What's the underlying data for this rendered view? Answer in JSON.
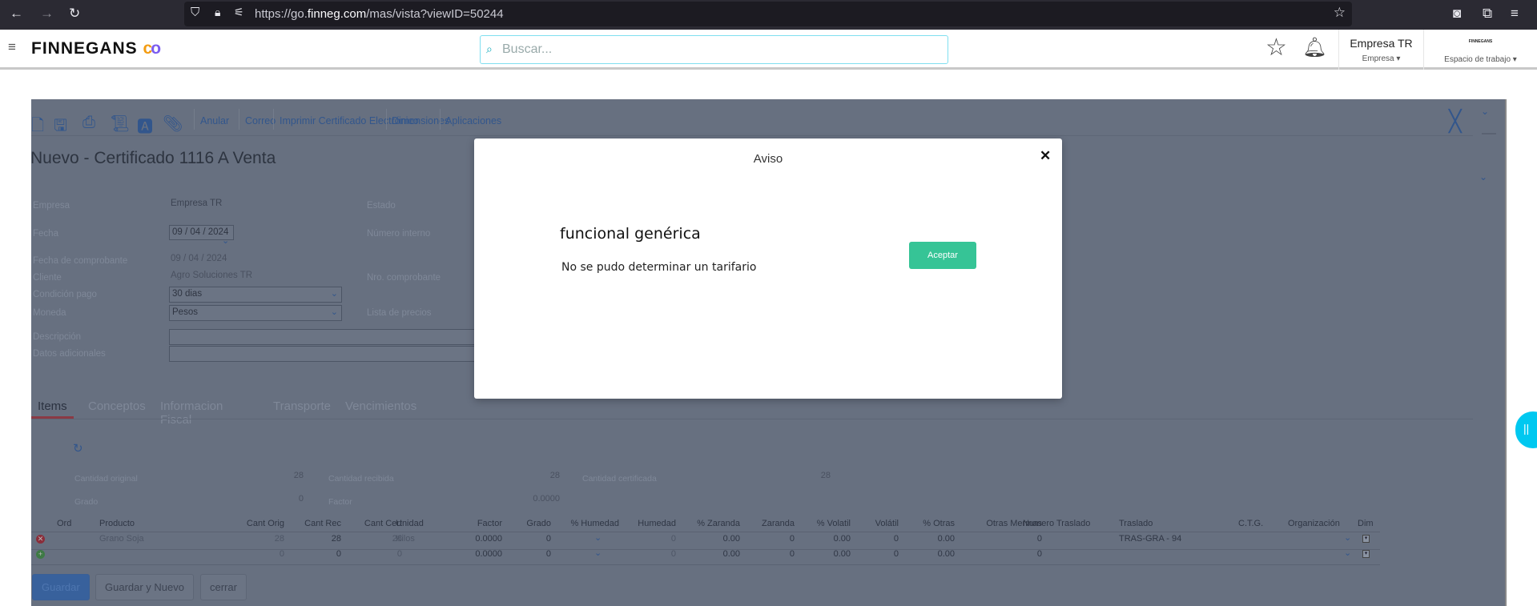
{
  "browser": {
    "url_prefix": "https://go.",
    "url_domain": "finneg.com",
    "url_suffix": "/mas/vista?viewID=50244"
  },
  "header": {
    "logo": "FINNEGANS",
    "search_placeholder": "Buscar...",
    "company": "Empresa TR",
    "company_label": "Empresa",
    "workspace_label": "Espacio de trabajo",
    "workspace_logo": "FINNEGANS"
  },
  "toolbar": {
    "links": [
      "Anular",
      "Correo",
      "Imprimir Certificado Electrónico",
      "Dimensiones",
      "Aplicaciones"
    ]
  },
  "form": {
    "title": "Nuevo - Certificado 1116 A Venta",
    "empresa_label": "Empresa",
    "empresa": "Empresa TR",
    "estado_label": "Estado",
    "fecha_label": "Fecha",
    "fecha": "09 / 04 / 2024",
    "numero_interno_label": "Número interno",
    "fecha_comp_label": "Fecha de comprobante",
    "fecha_comp": "09 / 04 / 2024",
    "cliente_label": "Cliente",
    "cliente": "Agro Soluciones TR",
    "nro_comp_label": "Nro. comprobante",
    "condicion_label": "Condición pago",
    "condicion": "30 dias",
    "moneda_label": "Moneda",
    "moneda": "Pesos",
    "lista_label": "Lista de precios",
    "descripcion_label": "Descripción",
    "datos_label": "Datos adicionales"
  },
  "tabs": [
    "Items",
    "Conceptos",
    "Informacion Fiscal",
    "Transporte",
    "Vencimientos"
  ],
  "summary": {
    "cant_orig_label": "Cantidad original",
    "cant_orig": "28",
    "cant_rec_label": "Cantidad recibida",
    "cant_rec": "28",
    "cant_cert_label": "Cantidad certificada",
    "cant_cert": "28",
    "grado_label": "Grado",
    "grado": "0",
    "factor_label": "Factor",
    "factor": "0.0000"
  },
  "table": {
    "headers": [
      "Ord",
      "Producto",
      "Cant Orig",
      "Cant Rec",
      "Cant Cert",
      "Unidad",
      "Factor",
      "Grado",
      "% Humedad",
      "Humedad",
      "% Zaranda",
      "Zaranda",
      "% Volatil",
      "Volátil",
      "% Otras",
      "Otras Mermas",
      "Numero Traslado",
      "Traslado",
      "C.T.G.",
      "Organización",
      "Dim"
    ],
    "rows": [
      [
        "",
        "Grano Soja",
        "28",
        "28",
        "28",
        "Kilos",
        "0.0000",
        "0",
        "",
        "0",
        "0.00",
        "0",
        "0.00",
        "0",
        "0.00",
        "0",
        "",
        "TRAS-GRA - 94",
        "",
        "",
        ""
      ],
      [
        "",
        "",
        "0",
        "0",
        "0",
        "",
        "0.0000",
        "0",
        "",
        "0",
        "0.00",
        "0",
        "0.00",
        "0",
        "0.00",
        "0",
        "",
        "",
        "",
        "",
        ""
      ]
    ]
  },
  "buttons": {
    "guardar": "Guardar",
    "guardar_nuevo": "Guardar y Nuevo",
    "cerrar": "cerrar"
  },
  "modal": {
    "title": "Aviso",
    "heading": "funcional genérica",
    "message": "No se pudo determinar un tarifario",
    "accept": "Aceptar"
  },
  "colors": {
    "accept": "#36c496",
    "overlay": "#677080",
    "fab": "#00c8f0"
  }
}
